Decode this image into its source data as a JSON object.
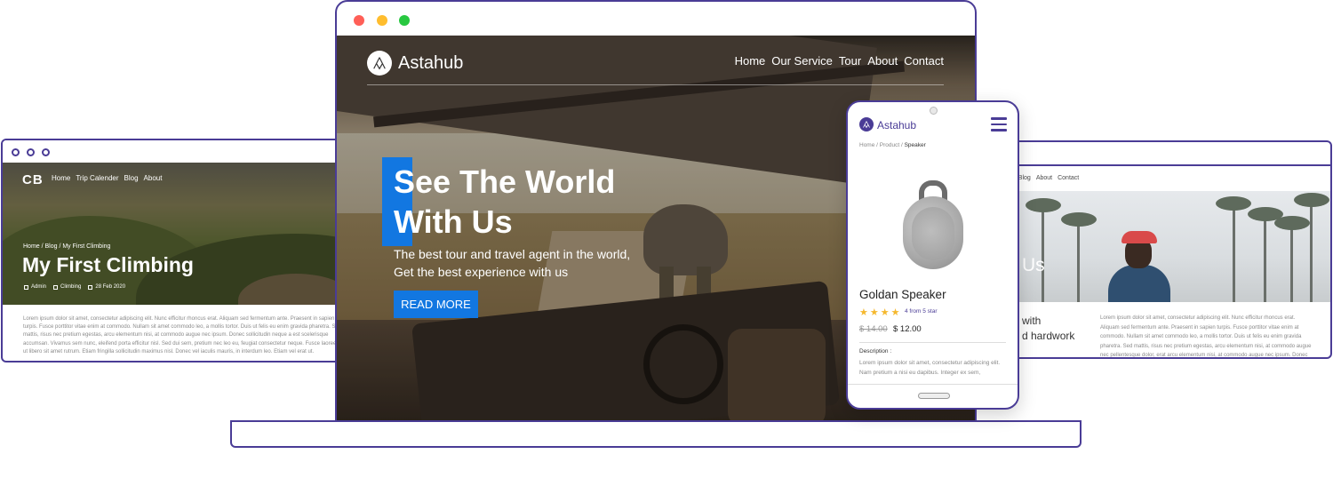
{
  "left_site": {
    "logo": "CB",
    "nav": [
      "Home",
      "Trip Calender",
      "Blog",
      "About"
    ],
    "breadcrumb": "Home / Blog / My First Climbing",
    "title": "My First Climbing",
    "meta": {
      "author": "Admin",
      "category": "Climbing",
      "date": "28 Feb 2020"
    },
    "body": "Lorem ipsum dolor sit amet, consectetur adipiscing elit. Nunc efficitur rhoncus erat. Aliquam sed fermentum ante. Praesent in sapien turpis. Fusce porttitor vitae enim at commodo. Nullam sit amet commodo leo, a mollis tortor. Duis ut felis eu enim gravida pharetra. Sed mattis, risus nec pretium egestas, arcu elementum nisi, at commodo augue nec ipsum. Donec sollicitudin neque a est scelerisque accumsan. Vivamus sem nunc, eleifend porta efficitur nisl. Sed dui sem, pretium nec leo eu, feugiat consectetur neque. Fusce laoreet ut libero sit amet rutrum. Etiam fringilla sollicitudin maximus nisl. Donec vel iaculis mauris, in interdum leo. Etiam vel erat ut."
  },
  "main_site": {
    "brand": "Astahub",
    "nav": [
      "Home",
      "Our Service",
      "Tour",
      "About",
      "Contact"
    ],
    "hero_title_line1": "See The World",
    "hero_title_line2": "With Us",
    "hero_sub_line1": "The best tour and travel agent in the world,",
    "hero_sub_line2": "Get the best experience with us",
    "cta": "READ MORE",
    "accent_color": "#1277e1"
  },
  "phone_site": {
    "brand": "Astahub",
    "breadcrumb_parts": [
      "Home",
      "Product"
    ],
    "breadcrumb_current": "Speaker",
    "product_title": "Goldan Speaker",
    "rating_stars": 4,
    "rating_text": "4 from 5 star",
    "old_price": "$ 14.00",
    "new_price": "$ 12.00",
    "description_heading": "Description :",
    "description": "Lorem ipsum dolor sit amet, consectetur adipiscing elit. Nam pretium a nisi eu dapibus. Integer ex sem,"
  },
  "right_site": {
    "nav": [
      "op",
      "Blog",
      "About",
      "Contact"
    ],
    "hero_partial": "Us",
    "tag_line1": "with",
    "tag_line2": "d hardwork",
    "body": "Lorem ipsum dolor sit amet, consectetur adipiscing elit. Nunc efficitur rhoncus erat. Aliquam sed fermentum ante. Praesent in sapien turpis. Fusce porttitor vitae enim at commodo. Nullam sit amet commodo leo, a mollis tortor. Duis ut felis eu enim gravida pharetra. Sed mattis, risus nec pretium egestas, arcu elementum nisi, at commodo augue nec pellentesque dolor, erat arcu elementum nisi, at commodo augue nec ipsum. Donec sollicitudin neque a est scelerisque accumsan. Vivamus sem nunc, eleifend porta tellus nec."
  },
  "colors": {
    "frame": "#4a3c96",
    "window_dot_red": "#ff5f57",
    "window_dot_yellow": "#ffbd2e",
    "window_dot_green": "#28c840",
    "star": "#f5b82e"
  }
}
